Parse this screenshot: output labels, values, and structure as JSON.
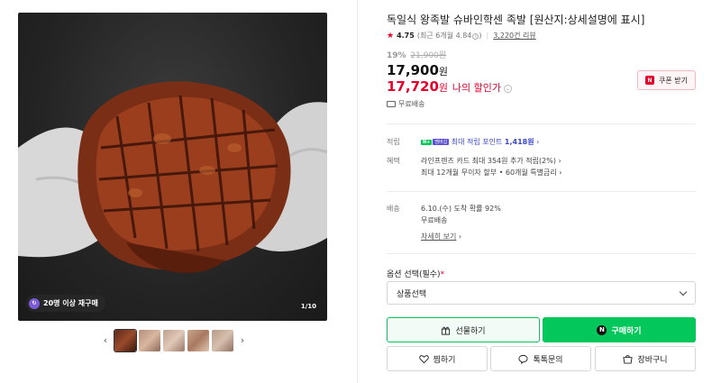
{
  "gallery": {
    "badge_text": "20명 이상 재구매",
    "badge_icon": "repurchase-icon",
    "page_indicator": "1/10",
    "thumbnail_count": 5,
    "active_thumbnail": 1
  },
  "product": {
    "title": "독일식 왕족발 슈바인학센 족발 [원산지:상세설명에 표시]",
    "rating": "4.75",
    "rating_detail": "(최근 6개월 4.84",
    "review_count": "3,220건 리뷰",
    "discount_rate": "19%",
    "original_price": "21,900원",
    "price": "17,900",
    "price_unit": "원",
    "my_price": "17,720",
    "my_price_unit": "원",
    "my_price_label": "나의 할인가",
    "shipping": "무료배송"
  },
  "coupon": {
    "label": "쿠폰 받기",
    "color": "#e4002b"
  },
  "benefits": {
    "point_key": "적립",
    "point_badge_a": "N+",
    "point_badge_b": "멤버십",
    "point_text_prefix": "최대 적립 포인트",
    "point_amount": "1,418원",
    "benefit_key": "혜택",
    "benefit_line1": "라인프렌즈 카드 최대 354원 추가 적립(2%)",
    "benefit_line2": "최대 12개월 무이자 할부 • 60개월 특별금리",
    "delivery_key": "배송",
    "delivery_line1": "6.10.(수) 도착 확률 92%",
    "delivery_line2": "무료배송",
    "delivery_more": "자세히 보기"
  },
  "options": {
    "label": "옵션 선택",
    "required_label": "(필수)",
    "required_mark": "*",
    "select_value": "상품선택"
  },
  "actions": {
    "gift": "선물하기",
    "buy": "구매하기",
    "wish": "찜하기",
    "qna": "톡톡문의",
    "cart": "장바구니"
  },
  "colors": {
    "accent_green": "#03c75a",
    "sale_red": "#e4002b",
    "point_blue": "#3b46c9"
  }
}
